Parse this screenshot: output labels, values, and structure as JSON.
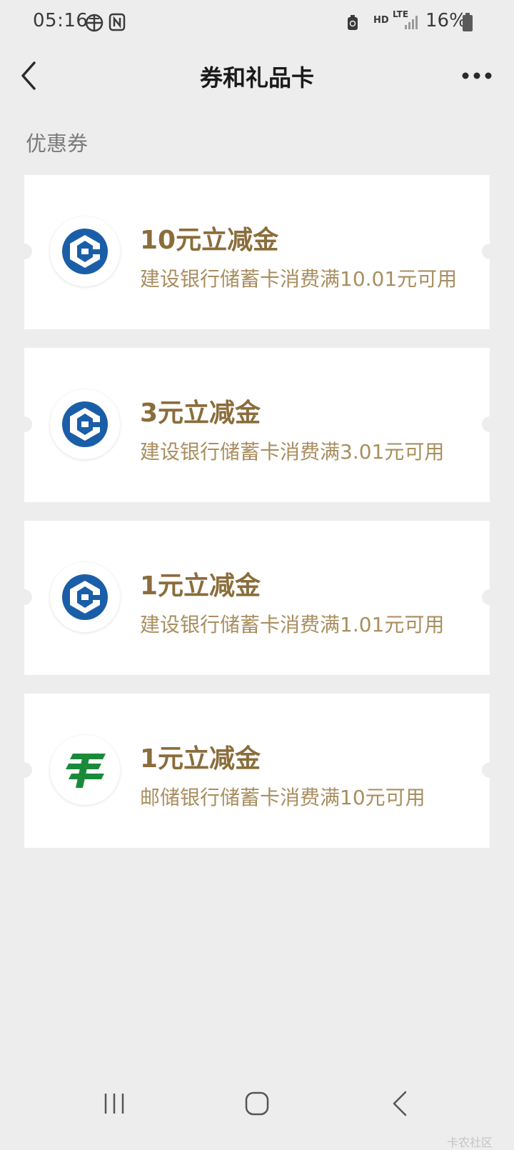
{
  "status_bar": {
    "time": "05:16",
    "battery": "16%",
    "network_hd": "HD",
    "network_type": "LTE",
    "icons": [
      "vpn-globe-icon",
      "nfc-icon",
      "recycle-icon",
      "signal-icon",
      "battery-icon"
    ]
  },
  "nav": {
    "title": "券和礼品卡",
    "back_icon": "chevron-left-icon",
    "more_icon": "more-dots-icon"
  },
  "section": {
    "label": "优惠券"
  },
  "coupons": [
    {
      "title": "10元立减金",
      "desc": "建设银行储蓄卡消费满10.01元可用",
      "bank_logo": "ccb-logo-icon"
    },
    {
      "title": "3元立减金",
      "desc": "建设银行储蓄卡消费满3.01元可用",
      "bank_logo": "ccb-logo-icon"
    },
    {
      "title": "1元立减金",
      "desc": "建设银行储蓄卡消费满1.01元可用",
      "bank_logo": "ccb-logo-icon"
    },
    {
      "title": "1元立减金",
      "desc": "邮储银行储蓄卡消费满10元可用",
      "bank_logo": "psbc-logo-icon"
    }
  ],
  "colors": {
    "background": "#ededed",
    "card": "#ffffff",
    "coupon_title": "#8a6d3b",
    "coupon_desc": "#a98e5f",
    "ccb_blue": "#1a5ea8",
    "psbc_green": "#1a8a3a"
  },
  "system_nav": {
    "icons": [
      "recents-icon",
      "home-icon",
      "back-icon"
    ]
  },
  "watermark": "卡农社区"
}
